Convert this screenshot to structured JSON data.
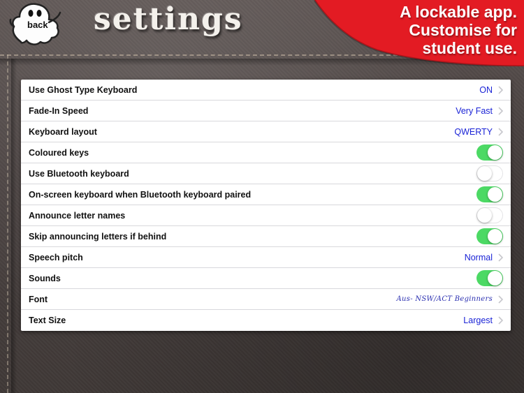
{
  "header": {
    "back_label": "back",
    "title": "settings"
  },
  "promo": {
    "lines": [
      "A lockable app.",
      "Customise for",
      "student use."
    ],
    "color": "#e31b23"
  },
  "settings": [
    {
      "label": "Use Ghost Type Keyboard",
      "type": "value",
      "value": "ON"
    },
    {
      "label": "Fade-In Speed",
      "type": "value",
      "value": "Very Fast"
    },
    {
      "label": "Keyboard layout",
      "type": "value",
      "value": "QWERTY"
    },
    {
      "label": "Coloured keys",
      "type": "toggle",
      "on": true
    },
    {
      "label": "Use Bluetooth keyboard",
      "type": "toggle",
      "on": false
    },
    {
      "label": "On-screen keyboard when Bluetooth keyboard paired",
      "type": "toggle",
      "on": true
    },
    {
      "label": "Announce letter names",
      "type": "toggle",
      "on": false
    },
    {
      "label": "Skip announcing letters if behind",
      "type": "toggle",
      "on": true
    },
    {
      "label": "Speech pitch",
      "type": "value",
      "value": "Normal"
    },
    {
      "label": "Sounds",
      "type": "toggle",
      "on": true
    },
    {
      "label": "Font",
      "type": "value",
      "value": "Aus- NSW/ACT Beginners"
    },
    {
      "label": "Text Size",
      "type": "value",
      "value": "Largest"
    }
  ],
  "colors": {
    "toggle_on": "#4cd964",
    "value_text": "#1a23d6"
  }
}
